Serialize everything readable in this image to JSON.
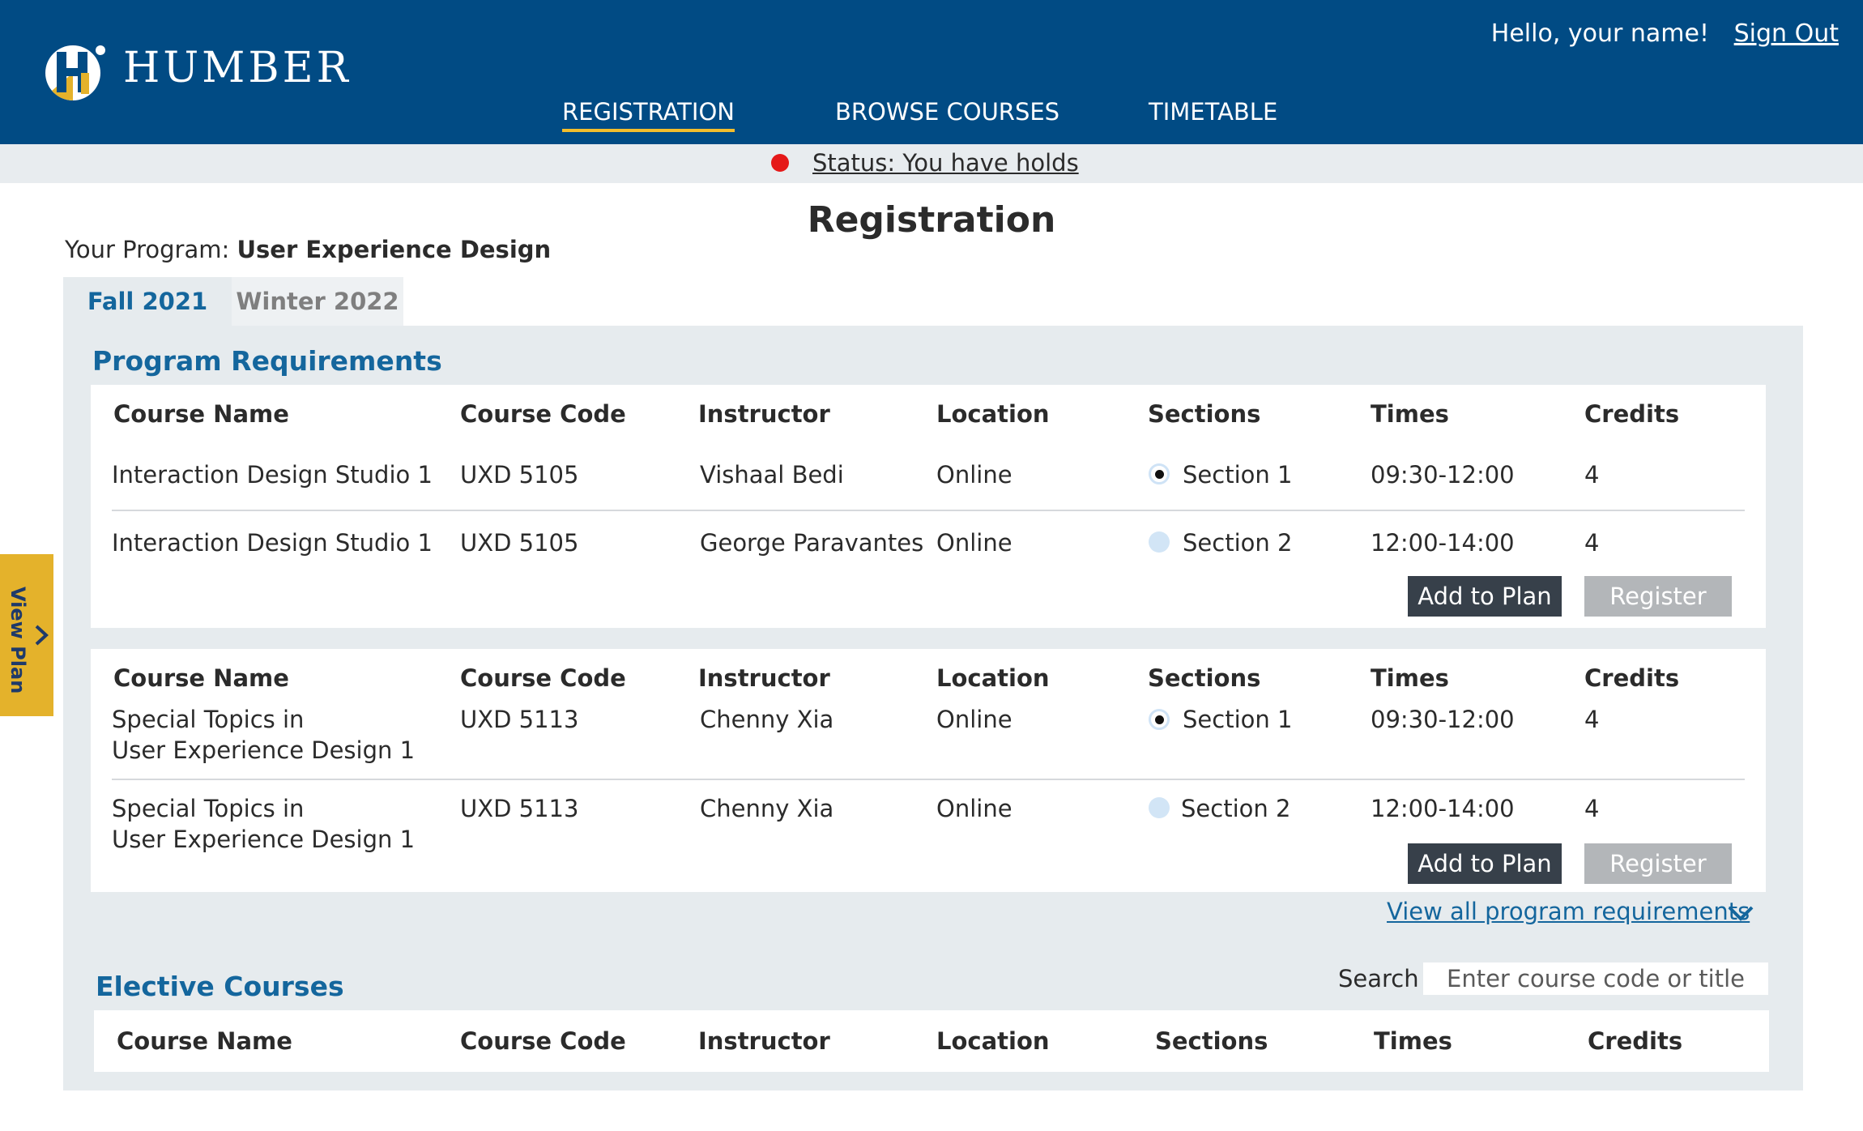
{
  "header": {
    "logo_text": "HUMBER",
    "greeting": "Hello, your name!",
    "sign_out": "Sign Out",
    "nav": [
      {
        "label": "REGISTRATION",
        "active": true
      },
      {
        "label": "BROWSE COURSES",
        "active": false
      },
      {
        "label": "TIMETABLE",
        "active": false
      }
    ],
    "colors": {
      "bar": "#014b84",
      "accent": "#f3bd2c"
    }
  },
  "status": {
    "text": "Status: You have holds",
    "dot_color": "#e51919"
  },
  "page": {
    "title": "Registration",
    "program_label": "Your Program:",
    "program_name": "User Experience Design"
  },
  "tabs": [
    {
      "label": "Fall 2021",
      "active": true
    },
    {
      "label": "Winter 2022",
      "active": false
    }
  ],
  "side_panel": {
    "label": "View Plan",
    "icon": "chevron-right-icon"
  },
  "columns": [
    "Course Name",
    "Course Code",
    "Instructor",
    "Location",
    "Sections",
    "Times",
    "Credits"
  ],
  "program_requirements": {
    "title": "Program Requirements",
    "groups": [
      {
        "rows": [
          {
            "name": "Interaction Design Studio 1",
            "code": "UXD 5105",
            "instructor": "Vishaal Bedi",
            "location": "Online",
            "section": "Section 1",
            "selected": true,
            "times": "09:30-12:00",
            "credits": "4"
          },
          {
            "name": "Interaction Design Studio 1",
            "code": "UXD 5105",
            "instructor": "George Paravantes",
            "location": "Online",
            "section": "Section 2",
            "selected": false,
            "times": "12:00-14:00",
            "credits": "4"
          }
        ],
        "add_label": "Add to Plan",
        "register_label": "Register"
      },
      {
        "rows": [
          {
            "name_line1": "Special Topics in",
            "name_line2": "User Experience Design 1",
            "code": "UXD 5113",
            "instructor": "Chenny Xia",
            "location": "Online",
            "section": "Section 1",
            "selected": true,
            "times": "09:30-12:00",
            "credits": "4"
          },
          {
            "name_line1": "Special Topics in",
            "name_line2": "User Experience Design 1",
            "code": "UXD 5113",
            "instructor": "Chenny Xia",
            "location": "Online",
            "section": "Section 2",
            "selected": false,
            "times": "12:00-14:00",
            "credits": "4"
          }
        ],
        "add_label": "Add to Plan",
        "register_label": "Register"
      }
    ],
    "view_all": "View all program requirements"
  },
  "elective_courses": {
    "title": "Elective Courses",
    "search_label": "Search",
    "search_placeholder": "Enter course code or title"
  }
}
